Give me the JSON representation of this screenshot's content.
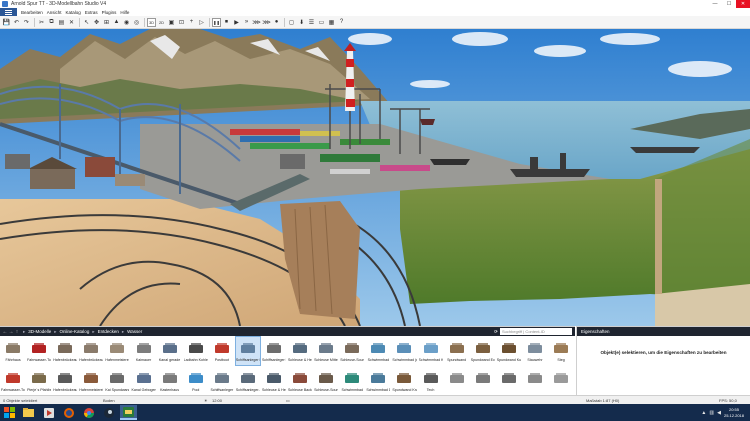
{
  "window": {
    "title": "Arnold Spur TT - 3D-Modellbahn Studio V4",
    "controls": [
      "—",
      "☐",
      "✕"
    ]
  },
  "menubar": {
    "file_tab": "",
    "items": [
      "Bearbeiten",
      "Ansicht",
      "Katalog",
      "Extras",
      "Plugins",
      "Hilfe"
    ]
  },
  "toolbar": {
    "icons": [
      "save-icon",
      "undo-icon",
      "redo-icon",
      "cut-icon",
      "copy-icon",
      "paste-icon",
      "delete-icon",
      "select-icon",
      "move-icon",
      "track-icon",
      "terrain-icon",
      "camera-icon",
      "eye-icon",
      "view-icon",
      "zoom-icon",
      "add-icon",
      "play-icon",
      "pause-icon",
      "stop-icon",
      "step-forward-icon",
      "fast-forward-icon",
      "faster-icon",
      "fastest-icon",
      "record-icon",
      "screenshot-icon",
      "download-icon",
      "layers-icon",
      "window-icon",
      "grid-icon",
      "help-icon"
    ],
    "btn_3d": "3D",
    "btn_2d": "2D"
  },
  "catalog": {
    "breadcrumb": [
      "3D-Modelle",
      "Online-Katalog",
      "Entdecken",
      "Wasser"
    ],
    "search_placeholder": "Suchbegriff | Content-ID",
    "items": [
      {
        "label": "Fährhaus",
        "color": "#8a7a66",
        "icon": "house-icon"
      },
      {
        "label": "Fahrwasser-Tonn...",
        "color": "#b22222",
        "icon": "buoy-icon"
      },
      {
        "label": "Hafenbrückeaufbau",
        "color": "#7a6a5a",
        "icon": "crane-icon"
      },
      {
        "label": "Hafenbrückeaufbau ab",
        "color": "#8a7b6b",
        "icon": "crane-icon"
      },
      {
        "label": "Hafenmeisterei",
        "color": "#9a8a76",
        "icon": "building-icon"
      },
      {
        "label": "Kaimauer",
        "color": "#7c7c7c",
        "icon": "wall-icon"
      },
      {
        "label": "Kanal gerade",
        "color": "#5a6f8a",
        "icon": "canal-icon"
      },
      {
        "label": "Ladbahn Kohle",
        "color": "#4a4a4a",
        "icon": "rail-icon"
      },
      {
        "label": "Postboot",
        "color": "#c0392b",
        "icon": "boat-icon"
      },
      {
        "label": "Schiffsanleger Lib...",
        "color": "#5f7f9f",
        "icon": "pier-icon"
      },
      {
        "label": "Schiffsanleger Be...",
        "color": "#6d6d6d",
        "icon": "pier-icon"
      },
      {
        "label": "Schleuse & Heser...",
        "color": "#556b7f",
        "icon": "lock-icon"
      },
      {
        "label": "Schleuse Mittelgrö...",
        "color": "#6b7b8b",
        "icon": "lock-icon"
      },
      {
        "label": "Schleuse-Sound...",
        "color": "#7a6a5a",
        "icon": "lock-icon"
      },
      {
        "label": "Schwimmbad",
        "color": "#4d8ab4",
        "icon": "pool-icon"
      },
      {
        "label": "Schwimmbad (ei...",
        "color": "#5b8fb8",
        "icon": "pool-icon"
      },
      {
        "label": "Schwimmbad Kin...",
        "color": "#6b9fc8",
        "icon": "pool-icon"
      },
      {
        "label": "Spundwand",
        "color": "#8b6f4f",
        "icon": "wall-icon"
      },
      {
        "label": "Spundwand Ecke",
        "color": "#7b5f3f",
        "icon": "wall-icon"
      },
      {
        "label": "Spundwand Kurve",
        "color": "#6b4f2f",
        "icon": "wall-icon"
      },
      {
        "label": "Stauwehr",
        "color": "#7d8d9d",
        "icon": "weir-icon"
      },
      {
        "label": "Steg",
        "color": "#9b7b55",
        "icon": "pier-icon"
      },
      {
        "label": "Fahrwasser-Tonn...",
        "color": "#c0392b",
        "icon": "buoy-icon"
      },
      {
        "label": "Pierje´s Pfahlbude",
        "color": "#7a6a4a",
        "icon": "hut-icon"
      },
      {
        "label": "Hafenbrückeaufbau",
        "color": "#5a5a5a",
        "icon": "crane-icon"
      },
      {
        "label": "Hafenmeisterei",
        "color": "#8a5a3a",
        "icon": "building-icon"
      },
      {
        "label": "Kai Spundwand",
        "color": "#6a6a6a",
        "icon": "wall-icon"
      },
      {
        "label": "Kanal Gebogen",
        "color": "#5a7090",
        "icon": "canal-icon"
      },
      {
        "label": "Kastenhaus",
        "color": "#7a7a7a",
        "icon": "building-icon"
      },
      {
        "label": "Pool",
        "color": "#3c8cc8",
        "icon": "pool-icon"
      },
      {
        "label": "Schiffsanleger",
        "color": "#6a7a8a",
        "icon": "pier-icon"
      },
      {
        "label": "Schiffsanleger-Pe...",
        "color": "#5a6a7a",
        "icon": "pier-icon"
      },
      {
        "label": "Schleuse & Heser",
        "color": "#4a5a6a",
        "icon": "lock-icon"
      },
      {
        "label": "Schleuse Backste...",
        "color": "#8a4a3a",
        "icon": "lock-icon"
      },
      {
        "label": "Schleuse-Sound...",
        "color": "#6a5a4a",
        "icon": "lock-icon"
      },
      {
        "label": "Schwimmbad",
        "color": "#2d8a7a",
        "icon": "pool-icon"
      },
      {
        "label": "Schwimmbad Do...",
        "color": "#4a7a9a",
        "icon": "pool-icon"
      },
      {
        "label": "Spundwand Kra...",
        "color": "#7a5a3a",
        "icon": "wall-icon"
      },
      {
        "label": "Tech",
        "color": "#5a5a5a",
        "icon": "tech-icon"
      },
      {
        "label": "",
        "color": "#8a8a8a",
        "icon": "wall-icon"
      },
      {
        "label": "",
        "color": "#7a7a7a",
        "icon": "wall-icon"
      },
      {
        "label": "",
        "color": "#6a6a6a",
        "icon": "wall-icon"
      },
      {
        "label": "",
        "color": "#8a8a8a",
        "icon": "wall-icon"
      },
      {
        "label": "",
        "color": "#9a9a9a",
        "icon": "wall-icon"
      }
    ],
    "selected_index": 9
  },
  "properties": {
    "title": "Eigenschaften",
    "message": "Objekt(e) selektieren, um die Eigenschaften zu bearbeiten"
  },
  "statusbar": {
    "selection": "0 Objekte selektiert",
    "layer": "Boden",
    "time": "12:00",
    "scale": "Maßstab 1:87 (H0)",
    "fps": "FPS: 50,0"
  },
  "taskbar": {
    "apps": [
      "explorer-icon",
      "media-icon",
      "firefox-icon",
      "chrome-icon",
      "steam-icon",
      "modelbahn-icon"
    ],
    "time": "20:55",
    "date": "25.12.2018"
  }
}
